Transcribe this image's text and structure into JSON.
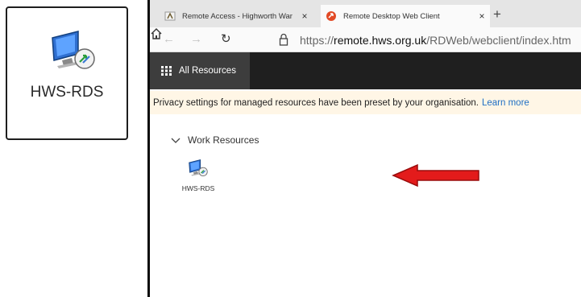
{
  "zoom_card": {
    "label": "HWS-RDS",
    "icon": "remote-desktop-icon"
  },
  "browser": {
    "tabs": [
      {
        "title": "Remote Access - Highworth War",
        "icon": "highworth-favicon",
        "close": "×",
        "active": false
      },
      {
        "title": "Remote Desktop Web Client",
        "icon": "rd-favicon",
        "close": "×",
        "active": true
      }
    ],
    "new_tab": "+",
    "nav": {
      "back": "←",
      "forward": "→",
      "refresh": "↻"
    },
    "address": {
      "scheme": "https://",
      "host": "remote.hws.org.uk",
      "path": "/RDWeb/webclient/index.htm"
    }
  },
  "appbar": {
    "all_resources": "All Resources"
  },
  "banner": {
    "message": "Privacy settings for managed resources have been preset by your organisation.",
    "link": "Learn more"
  },
  "resources": {
    "group": "Work Resources",
    "items": [
      {
        "label": "HWS-RDS",
        "icon": "remote-desktop-icon"
      }
    ]
  },
  "colors": {
    "arrow": "#e31b1b",
    "appbar": "#1f1f1f",
    "banner": "#fff6e6",
    "link": "#1f6fc4"
  }
}
